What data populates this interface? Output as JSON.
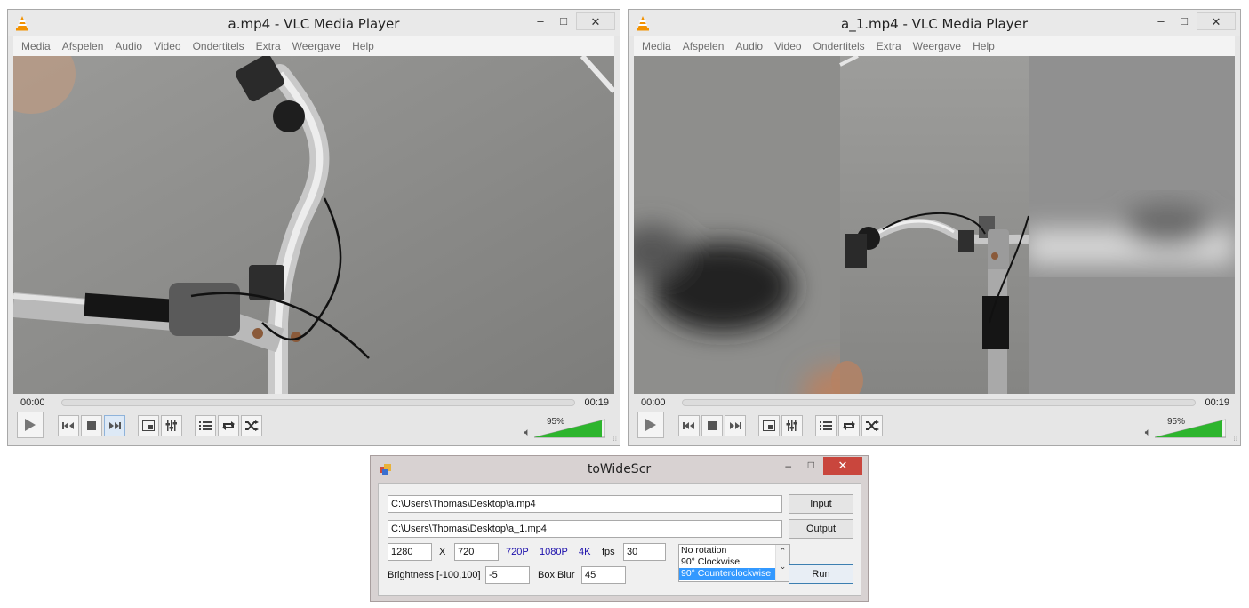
{
  "vlc_windows": [
    {
      "title": "a.mp4 - VLC Media Player",
      "menu": [
        "Media",
        "Afspelen",
        "Audio",
        "Video",
        "Ondertitels",
        "Extra",
        "Weergave",
        "Help"
      ],
      "time_current": "00:00",
      "time_total": "00:19",
      "volume_label": "95%",
      "volume": 0.95
    },
    {
      "title": "a_1.mp4 - VLC Media Player",
      "menu": [
        "Media",
        "Afspelen",
        "Audio",
        "Video",
        "Ondertitels",
        "Extra",
        "Weergave",
        "Help"
      ],
      "time_current": "00:00",
      "time_total": "00:19",
      "volume_label": "95%",
      "volume": 0.95
    }
  ],
  "window_controls": {
    "minimize": "‒",
    "maximize": "□",
    "close": "✕"
  },
  "towidescr": {
    "title": "toWideScr",
    "input_path": "C:\\Users\\Thomas\\Desktop\\a.mp4",
    "input_button": "Input",
    "output_path": "C:\\Users\\Thomas\\Desktop\\a_1.mp4",
    "output_button": "Output",
    "width": "1280",
    "x_label": "X",
    "height": "720",
    "preset_links": [
      "720P",
      "1080P",
      "4K"
    ],
    "fps_label": "fps",
    "fps": "30",
    "rotation_options": [
      "No rotation",
      "90° Clockwise",
      "90° Counterclockwise"
    ],
    "rotation_selected": "90° Counterclockwise",
    "brightness_label": "Brightness [-100,100]",
    "brightness": "-5",
    "blur_label": "Box Blur",
    "blur": "45",
    "run_button": "Run"
  },
  "colors": {
    "volume_green": "#2db52d",
    "close_red": "#c9463d",
    "selection_blue": "#3399ff",
    "link_blue": "#1a0dab"
  },
  "icons": [
    "vlc-cone-icon",
    "play-icon",
    "previous-icon",
    "stop-icon",
    "next-icon",
    "fullscreen-icon",
    "extended-settings-icon",
    "playlist-icon",
    "loop-icon",
    "shuffle-icon",
    "speaker-icon",
    "app-icon"
  ]
}
